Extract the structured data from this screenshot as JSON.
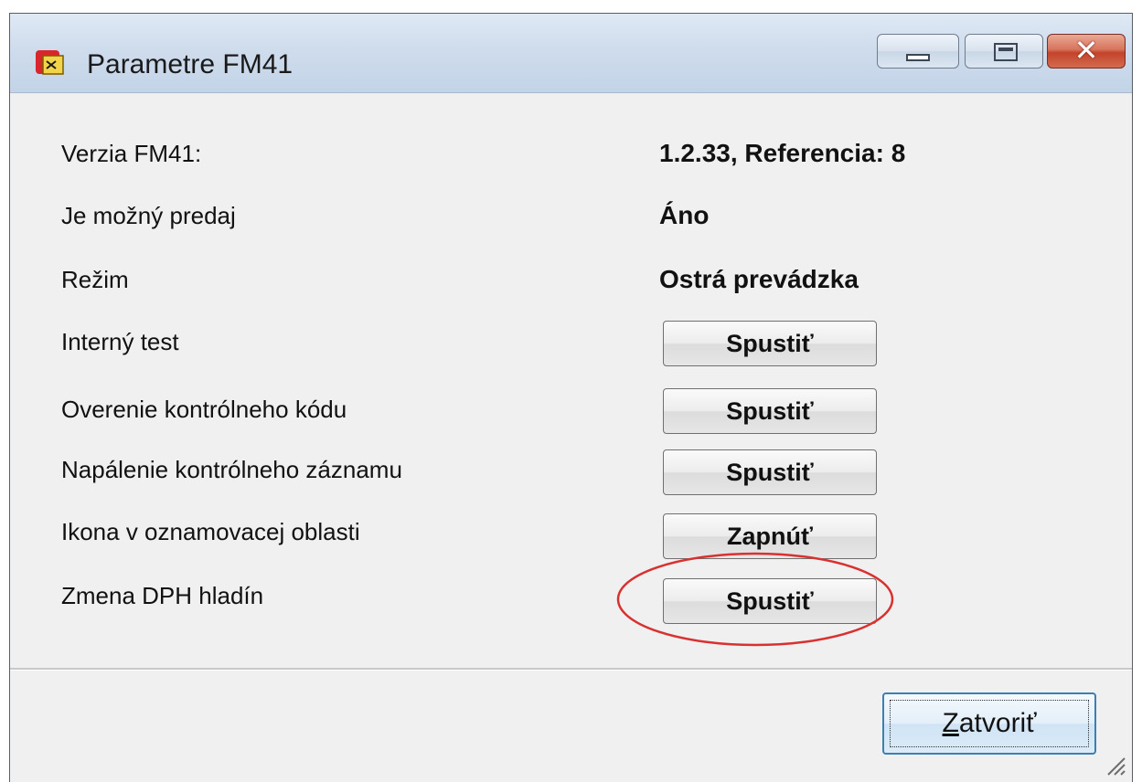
{
  "window": {
    "title": "Parametre FM41",
    "controls": {
      "minimize": "minimize",
      "maximize": "maximize",
      "close": "close"
    }
  },
  "rows": [
    {
      "label": "Verzia FM41:",
      "value": "1.2.33, Referencia: 8"
    },
    {
      "label": "Je možný predaj",
      "value": "Áno"
    },
    {
      "label": "Režim",
      "value": "Ostrá prevádzka"
    },
    {
      "label": "Interný test",
      "button": "Spustiť"
    },
    {
      "label": "Overenie kontrólneho kódu",
      "button": "Spustiť"
    },
    {
      "label": "Napálenie kontrólneho záznamu",
      "button": "Spustiť"
    },
    {
      "label": "Ikona v oznamovacej oblasti",
      "button": "Zapnúť"
    },
    {
      "label": "Zmena DPH hladín",
      "button": "Spustiť"
    }
  ],
  "footer": {
    "close_accel": "Z",
    "close_rest": "atvoriť"
  },
  "annotation": {
    "color": "#d93030"
  },
  "colors": {
    "titlebar": "#cfdcec",
    "window_bg": "#f0f0f0",
    "close_btn_focus": "#3c7fb1"
  }
}
